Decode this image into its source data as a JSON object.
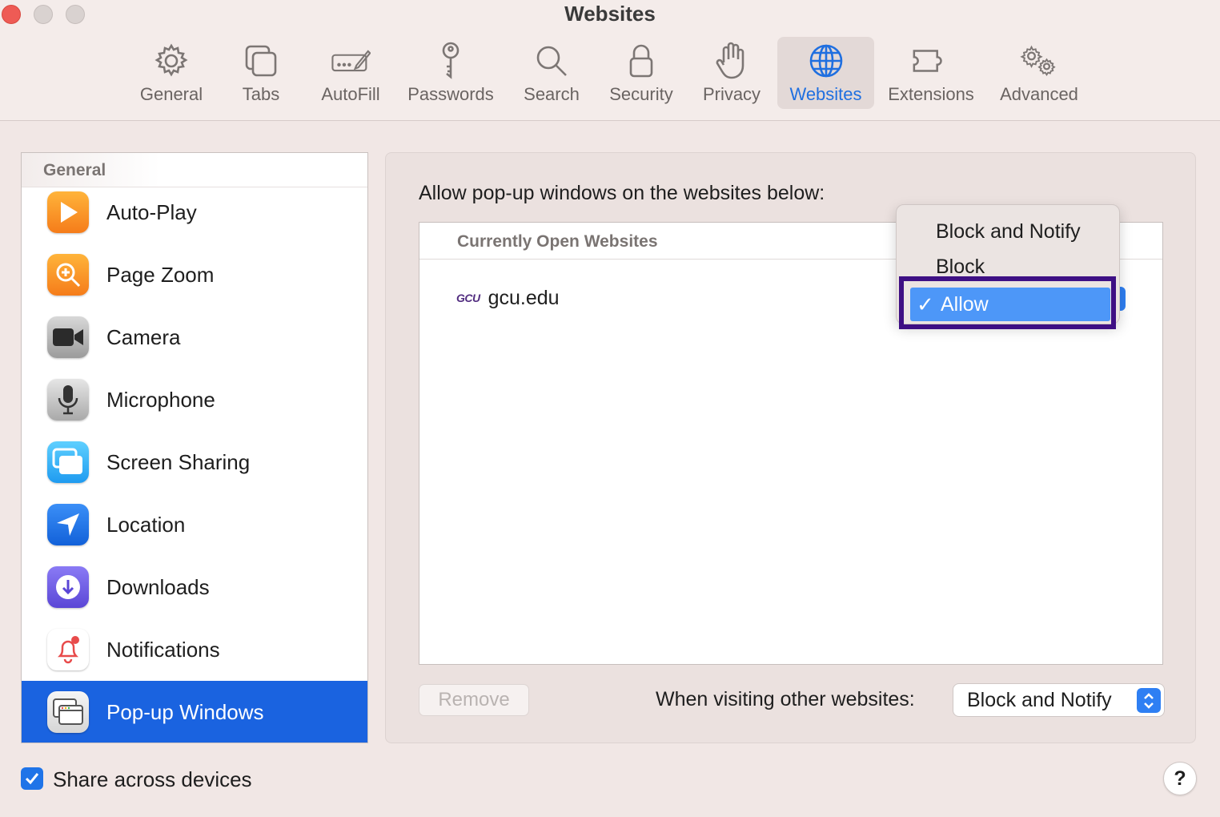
{
  "window": {
    "title": "Websites"
  },
  "toolbar": {
    "tabs": [
      {
        "label": "General",
        "icon": "gear-icon"
      },
      {
        "label": "Tabs",
        "icon": "tabs-icon"
      },
      {
        "label": "AutoFill",
        "icon": "autofill-icon"
      },
      {
        "label": "Passwords",
        "icon": "key-icon"
      },
      {
        "label": "Search",
        "icon": "magnifier-icon"
      },
      {
        "label": "Security",
        "icon": "lock-icon"
      },
      {
        "label": "Privacy",
        "icon": "hand-icon"
      },
      {
        "label": "Websites",
        "icon": "globe-icon",
        "active": true
      },
      {
        "label": "Extensions",
        "icon": "puzzle-icon"
      },
      {
        "label": "Advanced",
        "icon": "gears-icon"
      }
    ]
  },
  "sidebar": {
    "header": "General",
    "items": [
      {
        "label": "Auto-Play",
        "icon": "play-icon",
        "color": "#f7931e"
      },
      {
        "label": "Page Zoom",
        "icon": "zoom-icon",
        "color": "#f7931e"
      },
      {
        "label": "Camera",
        "icon": "camera-icon",
        "color": "#4a4a4a"
      },
      {
        "label": "Microphone",
        "icon": "microphone-icon",
        "color": "#9a9a9a"
      },
      {
        "label": "Screen Sharing",
        "icon": "screen-sharing-icon",
        "color": "#2ea8f5"
      },
      {
        "label": "Location",
        "icon": "location-arrow-icon",
        "color": "#1f74e8"
      },
      {
        "label": "Downloads",
        "icon": "download-icon",
        "color": "#6c5ce7"
      },
      {
        "label": "Notifications",
        "icon": "bell-icon",
        "color": "#ffffff"
      },
      {
        "label": "Pop-up Windows",
        "icon": "popup-windows-icon",
        "color": "#e9e9e9",
        "selected": true
      }
    ]
  },
  "main": {
    "title": "Allow pop-up windows on the websites below:",
    "table_header": "Currently Open Websites",
    "rows": [
      {
        "logo": "GCU",
        "site": "gcu.edu"
      }
    ],
    "remove_label": "Remove",
    "visiting_label": "When visiting other websites:",
    "visiting_value": "Block and Notify"
  },
  "menu": {
    "options": [
      "Block and Notify",
      "Block",
      "Allow"
    ],
    "selected": "Allow",
    "check": "✓"
  },
  "footer": {
    "share_label": "Share across devices",
    "share_checked": true,
    "help_label": "?"
  },
  "colors": {
    "accent": "#1f6fe0",
    "selection": "#1a63e0",
    "menu_highlight": "#4d97f8",
    "annotation_border": "#3e0f84"
  }
}
